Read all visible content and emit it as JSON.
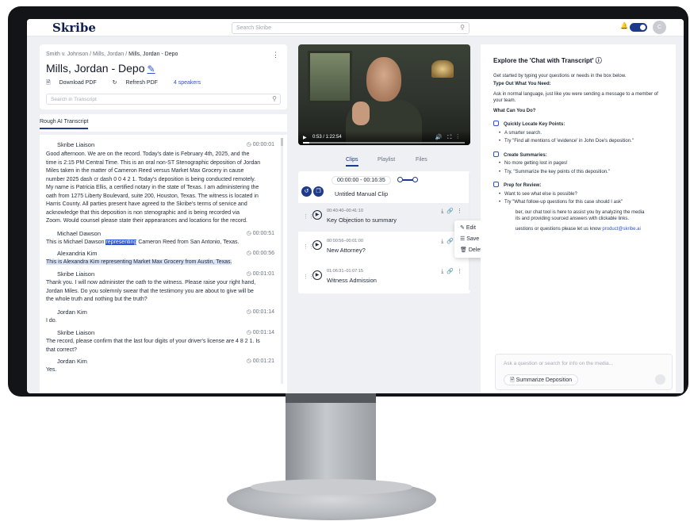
{
  "app": {
    "logo": "Skribe",
    "search_placeholder": "Search Skribe",
    "avatar_initial": "C"
  },
  "breadcrumb": [
    "Smith v. Johnson",
    "Mills, Jordan",
    "Mills, Jordan - Depo"
  ],
  "page_title": "Mills, Jordan - Depo",
  "actions": {
    "download": "Download PDF",
    "refresh": "Refresh PDF",
    "speakers": "4 speakers"
  },
  "transcript_search_placeholder": "Search in Transcript",
  "transcript_tab": "Rough AI Transcript",
  "transcript": [
    {
      "speaker": "Skribe Liaison",
      "time": "00:00:01"
    },
    {
      "speaker": "Michael Dawson",
      "time": "00:00:51"
    },
    {
      "speaker": "Alexandria Kim",
      "time": "00:00:56"
    },
    {
      "speaker": "Skribe Liaison",
      "time": "00:01:01"
    },
    {
      "speaker": "Jordan Kim",
      "time": "00:01:14"
    },
    {
      "speaker": "Skribe Liaison",
      "time": "00:01:14"
    },
    {
      "speaker": "Jordan Kim",
      "time": "00:01:21"
    }
  ],
  "transcript_lines": {
    "l1": "Good afternoon. We are on the record. Today's date is February 4th, 2025, and the",
    "l2": "time is 2:15 PM Central Time. This is an oral non-ST Stenographic deposition of Jordan",
    "l3": "Miles taken in the matter of Cameron Reed versus Market Max Grocery in cause",
    "l4": "number 2025 dash cr dash 0 0 4 2 1. Today's deposition is being conducted remotely.",
    "l5": "My name is Patricia Ellis, a certified notary in the state of Texas. I am administering the",
    "l6": "oath from 1275 Liberty Boulevard, suite 200, Houston, Texas. The witness is located in",
    "l7": "Harris County. All parties present have agreed to the Skribe's terms of service and",
    "l8": "acknowledge that this deposition is non stenographic and is being recorded via",
    "l9": "Zoom. Would counsel please state their appearances and locations for the record.",
    "l10a": "This is Michael Dawson ",
    "l10b": "representing",
    "l10c": " Cameron Reed from San Antonio, Texas.",
    "l11": "This is Alexandra Kim representing Market Max Grocery from Austin, Texas.",
    "l12": "Thank you. I will now administer the oath to the witness. Please raise your right hand,",
    "l13": "Jordan Miles. Do you solemnly swear that the testimony you are about to give will be",
    "l14": "the whole truth and nothing but the truth?",
    "l15": "I do.",
    "l16": "The record, please confirm that the last four digits of your driver's license are 4 8 2 1. Is",
    "l17": "that correct?",
    "l18": "Yes."
  },
  "video": {
    "time": "0:53 / 1:22:54"
  },
  "clip_tabs": [
    "Clips",
    "Playlist",
    "Files"
  ],
  "untitled_clip": {
    "range": "00:00:00  -  00:16:35",
    "title": "Untitled Manual Clip"
  },
  "clips": [
    {
      "time": "00:40:40–00:41:10",
      "title": "Key Objection to summary"
    },
    {
      "time": "00:00:56–00:01:00",
      "title": "New Attorney?"
    },
    {
      "time": "01:06:31–01:07:15",
      "title": "Witness Admission"
    }
  ],
  "context_menu": [
    "Edit",
    "Save to playlist",
    "Delete"
  ],
  "chat": {
    "heading": "Explore the 'Chat with Transcript'",
    "intro": "Get started by typing your questions or needs in the box below.",
    "type_out_head": "Type Out What You Need:",
    "type_out_body": "Ask in normal language, just like you were sending a message to a member of your team.",
    "can_do_head": "What Can You Do?",
    "features": [
      {
        "title": "Quickly Locate Key Points:",
        "bullets": [
          "A smarter search.",
          "Try \"Find all mentions of 'evidence' in John Doe's deposition.\""
        ]
      },
      {
        "title": "Create Summaries:",
        "bullets": [
          "No more getting lost in pages!",
          "Try, \"Summarize the key points of this deposition.\""
        ]
      },
      {
        "title": "Prep for Review:",
        "bullets": [
          "Want to see what else is possible?",
          "Try \"What follow-up questions for this case should I ask\""
        ]
      }
    ],
    "outro1": "ber, our chat tool is here to assist you by analyzing the media",
    "outro2": "its and providing sourced answers with clickable links.",
    "outro3": "uestions or questions please let us know ",
    "outro_link": "product@skribe.ai",
    "ask_placeholder": "Ask a question or search for info on the media...",
    "summarize_button": "Summarize Deposition"
  },
  "colors": {
    "brand": "#1e3a8a",
    "accent": "#2f4fd6",
    "highlight": "#2a57d6"
  }
}
